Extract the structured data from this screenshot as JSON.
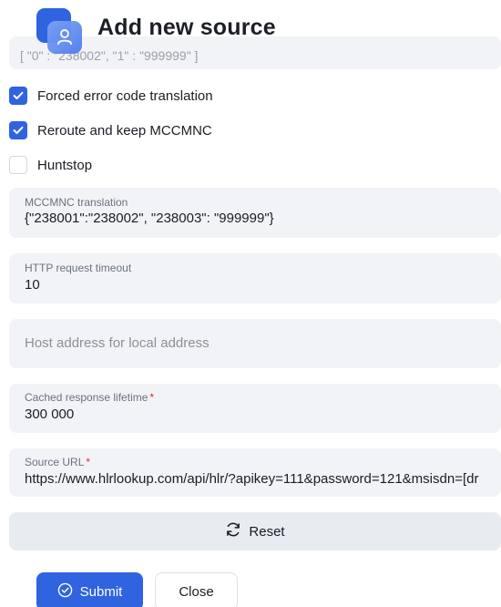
{
  "header": {
    "title": "Add new source",
    "icon": "user-card-icon",
    "accent": "#2f63e0"
  },
  "scroll_remnant": "[ \"0\" : \"238002\", \"1\" : \"999999\" ]",
  "checkboxes": [
    {
      "label": "Forced error code translation",
      "checked": true
    },
    {
      "label": "Reroute and keep MCCMNC",
      "checked": true
    },
    {
      "label": "Huntstop",
      "checked": false
    }
  ],
  "fields": {
    "mccmnc": {
      "label": "MCCMNC translation",
      "value": "{\"238001\":\"238002\", \"238003\": \"999999\"}"
    },
    "timeout": {
      "label": "HTTP request timeout",
      "value": "10"
    },
    "host": {
      "placeholder": "Host address for local address"
    },
    "cache": {
      "label": "Cached response lifetime",
      "required": "*",
      "value": "300 000"
    },
    "url": {
      "label": "Source URL",
      "required": "*",
      "value": "https://www.hlrlookup.com/api/hlr/?apikey=111&password=121&msisdn=[dr"
    }
  },
  "buttons": {
    "reset": "Reset",
    "submit": "Submit",
    "close": "Close"
  },
  "colors": {
    "primary": "#2f63e0",
    "field_bg": "#f1f3f6",
    "required": "#e0283a"
  }
}
